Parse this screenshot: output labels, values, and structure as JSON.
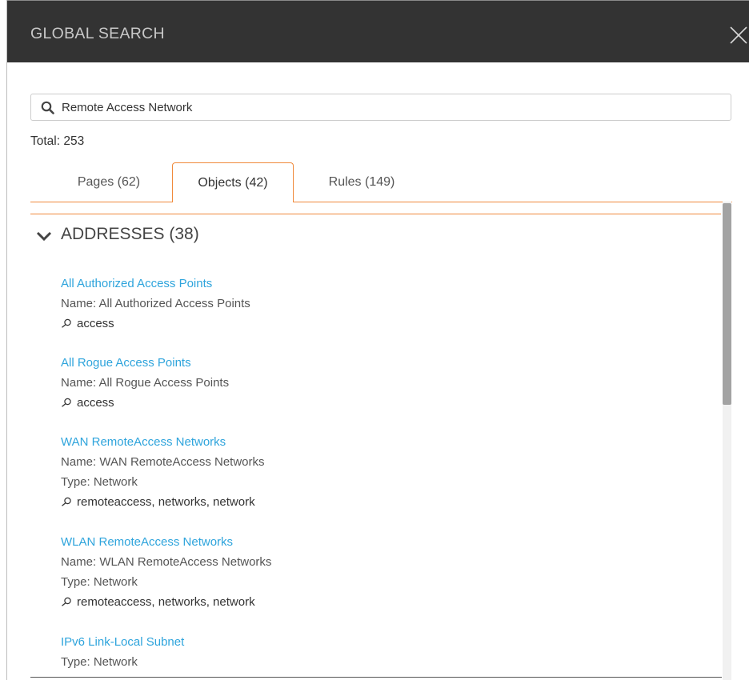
{
  "header": {
    "title": "GLOBAL SEARCH"
  },
  "search": {
    "value": "Remote Access Network"
  },
  "total": {
    "text": "Total: 253"
  },
  "tabs": [
    {
      "label": "Pages (62)",
      "active": false
    },
    {
      "label": "Objects (42)",
      "active": true
    },
    {
      "label": "Rules (149)",
      "active": false
    }
  ],
  "section": {
    "title": "ADDRESSES (38)",
    "expanded": true
  },
  "results": [
    {
      "title": "All Authorized Access Points",
      "name": "Name: All Authorized Access Points",
      "tags": "access"
    },
    {
      "title": "All Rogue Access Points",
      "name": "Name: All Rogue Access Points",
      "tags": "access"
    },
    {
      "title": "WAN RemoteAccess Networks",
      "name": "Name: WAN RemoteAccess Networks",
      "type": "Type: Network",
      "tags": "remoteaccess, networks, network"
    },
    {
      "title": "WLAN RemoteAccess Networks",
      "name": "Name: WLAN RemoteAccess Networks",
      "type": "Type: Network",
      "tags": "remoteaccess, networks, network"
    },
    {
      "title": "IPv6 Link-Local Subnet",
      "type": "Type: Network"
    }
  ],
  "icons": {
    "close": "close-icon",
    "search": "search-icon",
    "chevron": "chevron-down-icon",
    "tag": "tag-search-icon"
  },
  "colors": {
    "header_bg": "#333333",
    "accent": "#f08a3c",
    "link": "#2ea4dc"
  }
}
